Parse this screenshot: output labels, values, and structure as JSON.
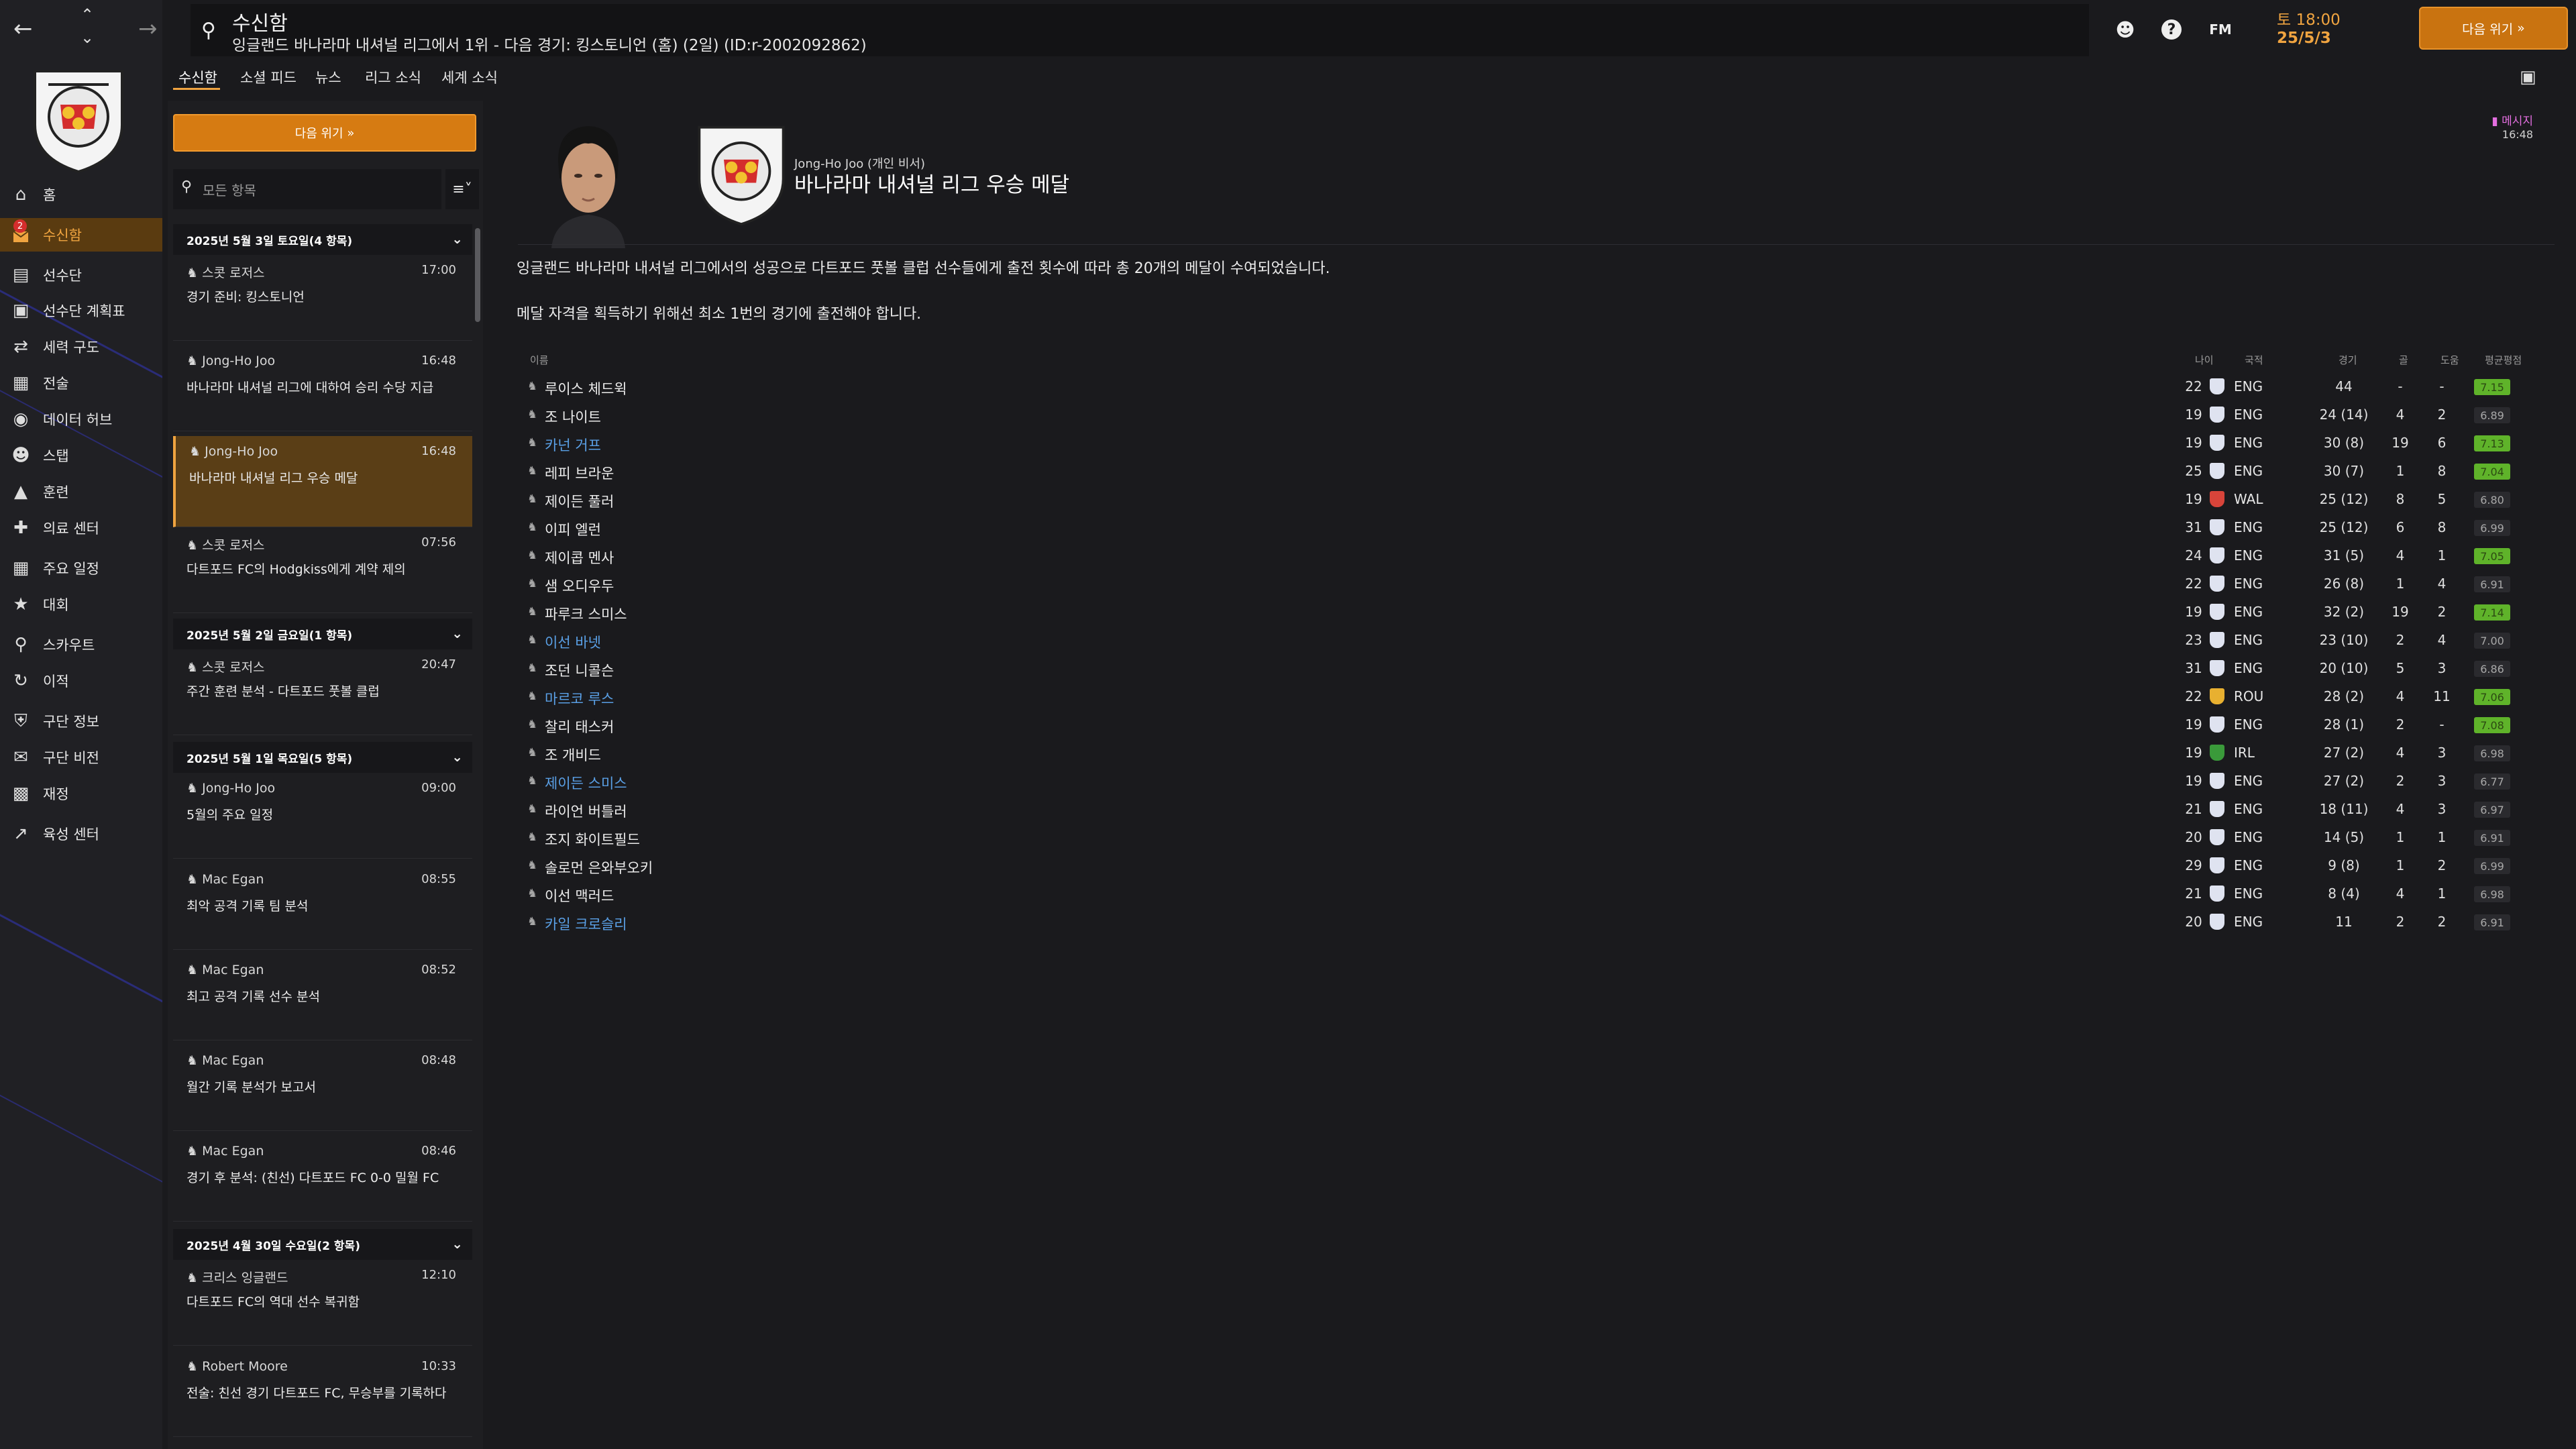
{
  "topbar": {
    "title": "수신함",
    "subtitle": "잉글랜드 바나라마 내셔널 리그에서 1위 - 다음 경기: 킹스토니언 (홈) (2일) (ID:r-2002092862)",
    "fm_label": "FM",
    "date_line1": "토 18:00",
    "date_line2": "25/5/3",
    "continue_label": "다음 위기"
  },
  "sidebar": {
    "items": [
      {
        "label": "홈",
        "icon": "home-icon"
      },
      {
        "label": "수신함",
        "icon": "inbox-icon",
        "badge": "2"
      },
      {
        "label": "선수단",
        "icon": "shirt-icon"
      },
      {
        "label": "선수단 계획표",
        "icon": "clipboard-icon"
      },
      {
        "label": "세력 구도",
        "icon": "hierarchy-icon"
      },
      {
        "label": "전술",
        "icon": "tactics-icon"
      },
      {
        "label": "데이터 허브",
        "icon": "data-hub-icon"
      },
      {
        "label": "스탭",
        "icon": "staff-icon"
      },
      {
        "label": "훈련",
        "icon": "training-icon"
      },
      {
        "label": "의료 센터",
        "icon": "medical-icon"
      },
      {
        "label": "주요 일정",
        "icon": "calendar-icon"
      },
      {
        "label": "대회",
        "icon": "trophy-icon"
      },
      {
        "label": "스카우트",
        "icon": "scout-icon"
      },
      {
        "label": "이적",
        "icon": "transfer-icon"
      },
      {
        "label": "구단 정보",
        "icon": "club-info-icon"
      },
      {
        "label": "구단 비전",
        "icon": "vision-icon"
      },
      {
        "label": "재정",
        "icon": "finance-icon"
      },
      {
        "label": "육성 센터",
        "icon": "development-icon"
      }
    ]
  },
  "subtabs": [
    "수신함",
    "소셜 피드",
    "뉴스",
    "리그 소식",
    "세계 소식"
  ],
  "inbox": {
    "continue_label": "다음 위기",
    "filter_placeholder": "모든 항목",
    "groups": [
      {
        "date": "2025년 5월 3일 토요일(4 항목)",
        "messages": [
          {
            "sender": "스콧 로저스",
            "time": "17:00",
            "subject": "경기 준비: 킹스토니언"
          },
          {
            "sender": "Jong-Ho Joo",
            "time": "16:48",
            "subject": "바나라마 내셔널 리그에 대하여 승리 수당 지급"
          },
          {
            "sender": "Jong-Ho Joo",
            "time": "16:48",
            "subject": "바나라마 내셔널 리그 우승 메달"
          },
          {
            "sender": "스콧 로저스",
            "time": "07:56",
            "subject": "다트포드 FC의 Hodgkiss에게 계약 제의"
          }
        ]
      },
      {
        "date": "2025년 5월 2일 금요일(1 항목)",
        "messages": [
          {
            "sender": "스콧 로저스",
            "time": "20:47",
            "subject": "주간 훈련 분석 - 다트포드 풋볼 클럽"
          }
        ]
      },
      {
        "date": "2025년 5월 1일 목요일(5 항목)",
        "messages": [
          {
            "sender": "Jong-Ho Joo",
            "time": "09:00",
            "subject": "5월의 주요 일정"
          },
          {
            "sender": "Mac Egan",
            "time": "08:55",
            "subject": "최악 공격 기록 팀 분석"
          },
          {
            "sender": "Mac Egan",
            "time": "08:52",
            "subject": "최고 공격 기록 선수 분석"
          },
          {
            "sender": "Mac Egan",
            "time": "08:48",
            "subject": "월간 기록 분석가 보고서"
          },
          {
            "sender": "Mac Egan",
            "time": "08:46",
            "subject": "경기 후 분석: (친선) 다트포드 FC 0-0 밀월 FC"
          }
        ]
      },
      {
        "date": "2025년 4월 30일 수요일(2 항목)",
        "messages": [
          {
            "sender": "크리스 잉글랜드",
            "time": "12:10",
            "subject": "다트포드 FC의 역대 선수 복귀함"
          },
          {
            "sender": "Robert Moore",
            "time": "10:33",
            "subject": "전술: 친선 경기 다트포드 FC, 무승부를 기록하다"
          }
        ]
      }
    ]
  },
  "message": {
    "from": "Jong-Ho Joo (개인 비서)",
    "title": "바나라마 내셔널 리그 우승 메달",
    "tag": "메시지",
    "time": "16:48",
    "body1": "잉글랜드 바나라마 내셔널 리그에서의 성공으로 다트포드 풋볼 클럽 선수들에게 출전 횟수에 따라 총 20개의 메달이 수여되었습니다.",
    "body2": "메달 자격을 획득하기 위해선 최소 1번의 경기에 출전해야 합니다."
  },
  "table": {
    "headers": {
      "name": "이름",
      "age": "나이",
      "nat": "국적",
      "apps": "경기",
      "goals": "골",
      "assists": "도움",
      "rating": "평균평점"
    },
    "rows": [
      {
        "name": "루이스 체드윅",
        "link": false,
        "age": "22",
        "nat": "ENG",
        "apps": "44",
        "goals": "-",
        "assists": "-",
        "rating": "7.15",
        "good": true
      },
      {
        "name": "조 나이트",
        "link": false,
        "age": "19",
        "nat": "ENG",
        "apps": "24 (14)",
        "goals": "4",
        "assists": "2",
        "rating": "6.89",
        "good": false
      },
      {
        "name": "카넌 거프",
        "link": true,
        "age": "19",
        "nat": "ENG",
        "apps": "30 (8)",
        "goals": "19",
        "assists": "6",
        "rating": "7.13",
        "good": true
      },
      {
        "name": "레피 브라운",
        "link": false,
        "age": "25",
        "nat": "ENG",
        "apps": "30 (7)",
        "goals": "1",
        "assists": "8",
        "rating": "7.04",
        "good": true
      },
      {
        "name": "제이든 풀러",
        "link": false,
        "age": "19",
        "nat": "WAL",
        "apps": "25 (12)",
        "goals": "8",
        "assists": "5",
        "rating": "6.80",
        "good": false
      },
      {
        "name": "이피 엘런",
        "link": false,
        "age": "31",
        "nat": "ENG",
        "apps": "25 (12)",
        "goals": "6",
        "assists": "8",
        "rating": "6.99",
        "good": false
      },
      {
        "name": "제이콥 멘사",
        "link": false,
        "age": "24",
        "nat": "ENG",
        "apps": "31 (5)",
        "goals": "4",
        "assists": "1",
        "rating": "7.05",
        "good": true
      },
      {
        "name": "샘 오디우두",
        "link": false,
        "age": "22",
        "nat": "ENG",
        "apps": "26 (8)",
        "goals": "1",
        "assists": "4",
        "rating": "6.91",
        "good": false
      },
      {
        "name": "파루크 스미스",
        "link": false,
        "age": "19",
        "nat": "ENG",
        "apps": "32 (2)",
        "goals": "19",
        "assists": "2",
        "rating": "7.14",
        "good": true
      },
      {
        "name": "이선 바넷",
        "link": true,
        "age": "23",
        "nat": "ENG",
        "apps": "23 (10)",
        "goals": "2",
        "assists": "4",
        "rating": "7.00",
        "good": false
      },
      {
        "name": "조던 니콜슨",
        "link": false,
        "age": "31",
        "nat": "ENG",
        "apps": "20 (10)",
        "goals": "5",
        "assists": "3",
        "rating": "6.86",
        "good": false
      },
      {
        "name": "마르코 루스",
        "link": true,
        "age": "22",
        "nat": "ROU",
        "apps": "28 (2)",
        "goals": "4",
        "assists": "11",
        "rating": "7.06",
        "good": true
      },
      {
        "name": "찰리 태스커",
        "link": false,
        "age": "19",
        "nat": "ENG",
        "apps": "28 (1)",
        "goals": "2",
        "assists": "-",
        "rating": "7.08",
        "good": true
      },
      {
        "name": "조 개비드",
        "link": false,
        "age": "19",
        "nat": "IRL",
        "apps": "27 (2)",
        "goals": "4",
        "assists": "3",
        "rating": "6.98",
        "good": false
      },
      {
        "name": "제이든 스미스",
        "link": true,
        "age": "19",
        "nat": "ENG",
        "apps": "27 (2)",
        "goals": "2",
        "assists": "3",
        "rating": "6.77",
        "good": false
      },
      {
        "name": "라이언 버틀러",
        "link": false,
        "age": "21",
        "nat": "ENG",
        "apps": "18 (11)",
        "goals": "4",
        "assists": "3",
        "rating": "6.97",
        "good": false
      },
      {
        "name": "조지 화이트필드",
        "link": false,
        "age": "20",
        "nat": "ENG",
        "apps": "14 (5)",
        "goals": "1",
        "assists": "1",
        "rating": "6.91",
        "good": false
      },
      {
        "name": "솔로먼 은와부오키",
        "link": false,
        "age": "29",
        "nat": "ENG",
        "apps": "9 (8)",
        "goals": "1",
        "assists": "2",
        "rating": "6.99",
        "good": false
      },
      {
        "name": "이선 맥러드",
        "link": false,
        "age": "21",
        "nat": "ENG",
        "apps": "8 (4)",
        "goals": "4",
        "assists": "1",
        "rating": "6.98",
        "good": false
      },
      {
        "name": "카일 크로슬리",
        "link": true,
        "age": "20",
        "nat": "ENG",
        "apps": "11",
        "goals": "2",
        "assists": "2",
        "rating": "6.91",
        "good": false
      }
    ]
  },
  "colors": {
    "accent": "#f0a440",
    "link": "#5aa0e6",
    "rating_good": "#5fb32a"
  }
}
